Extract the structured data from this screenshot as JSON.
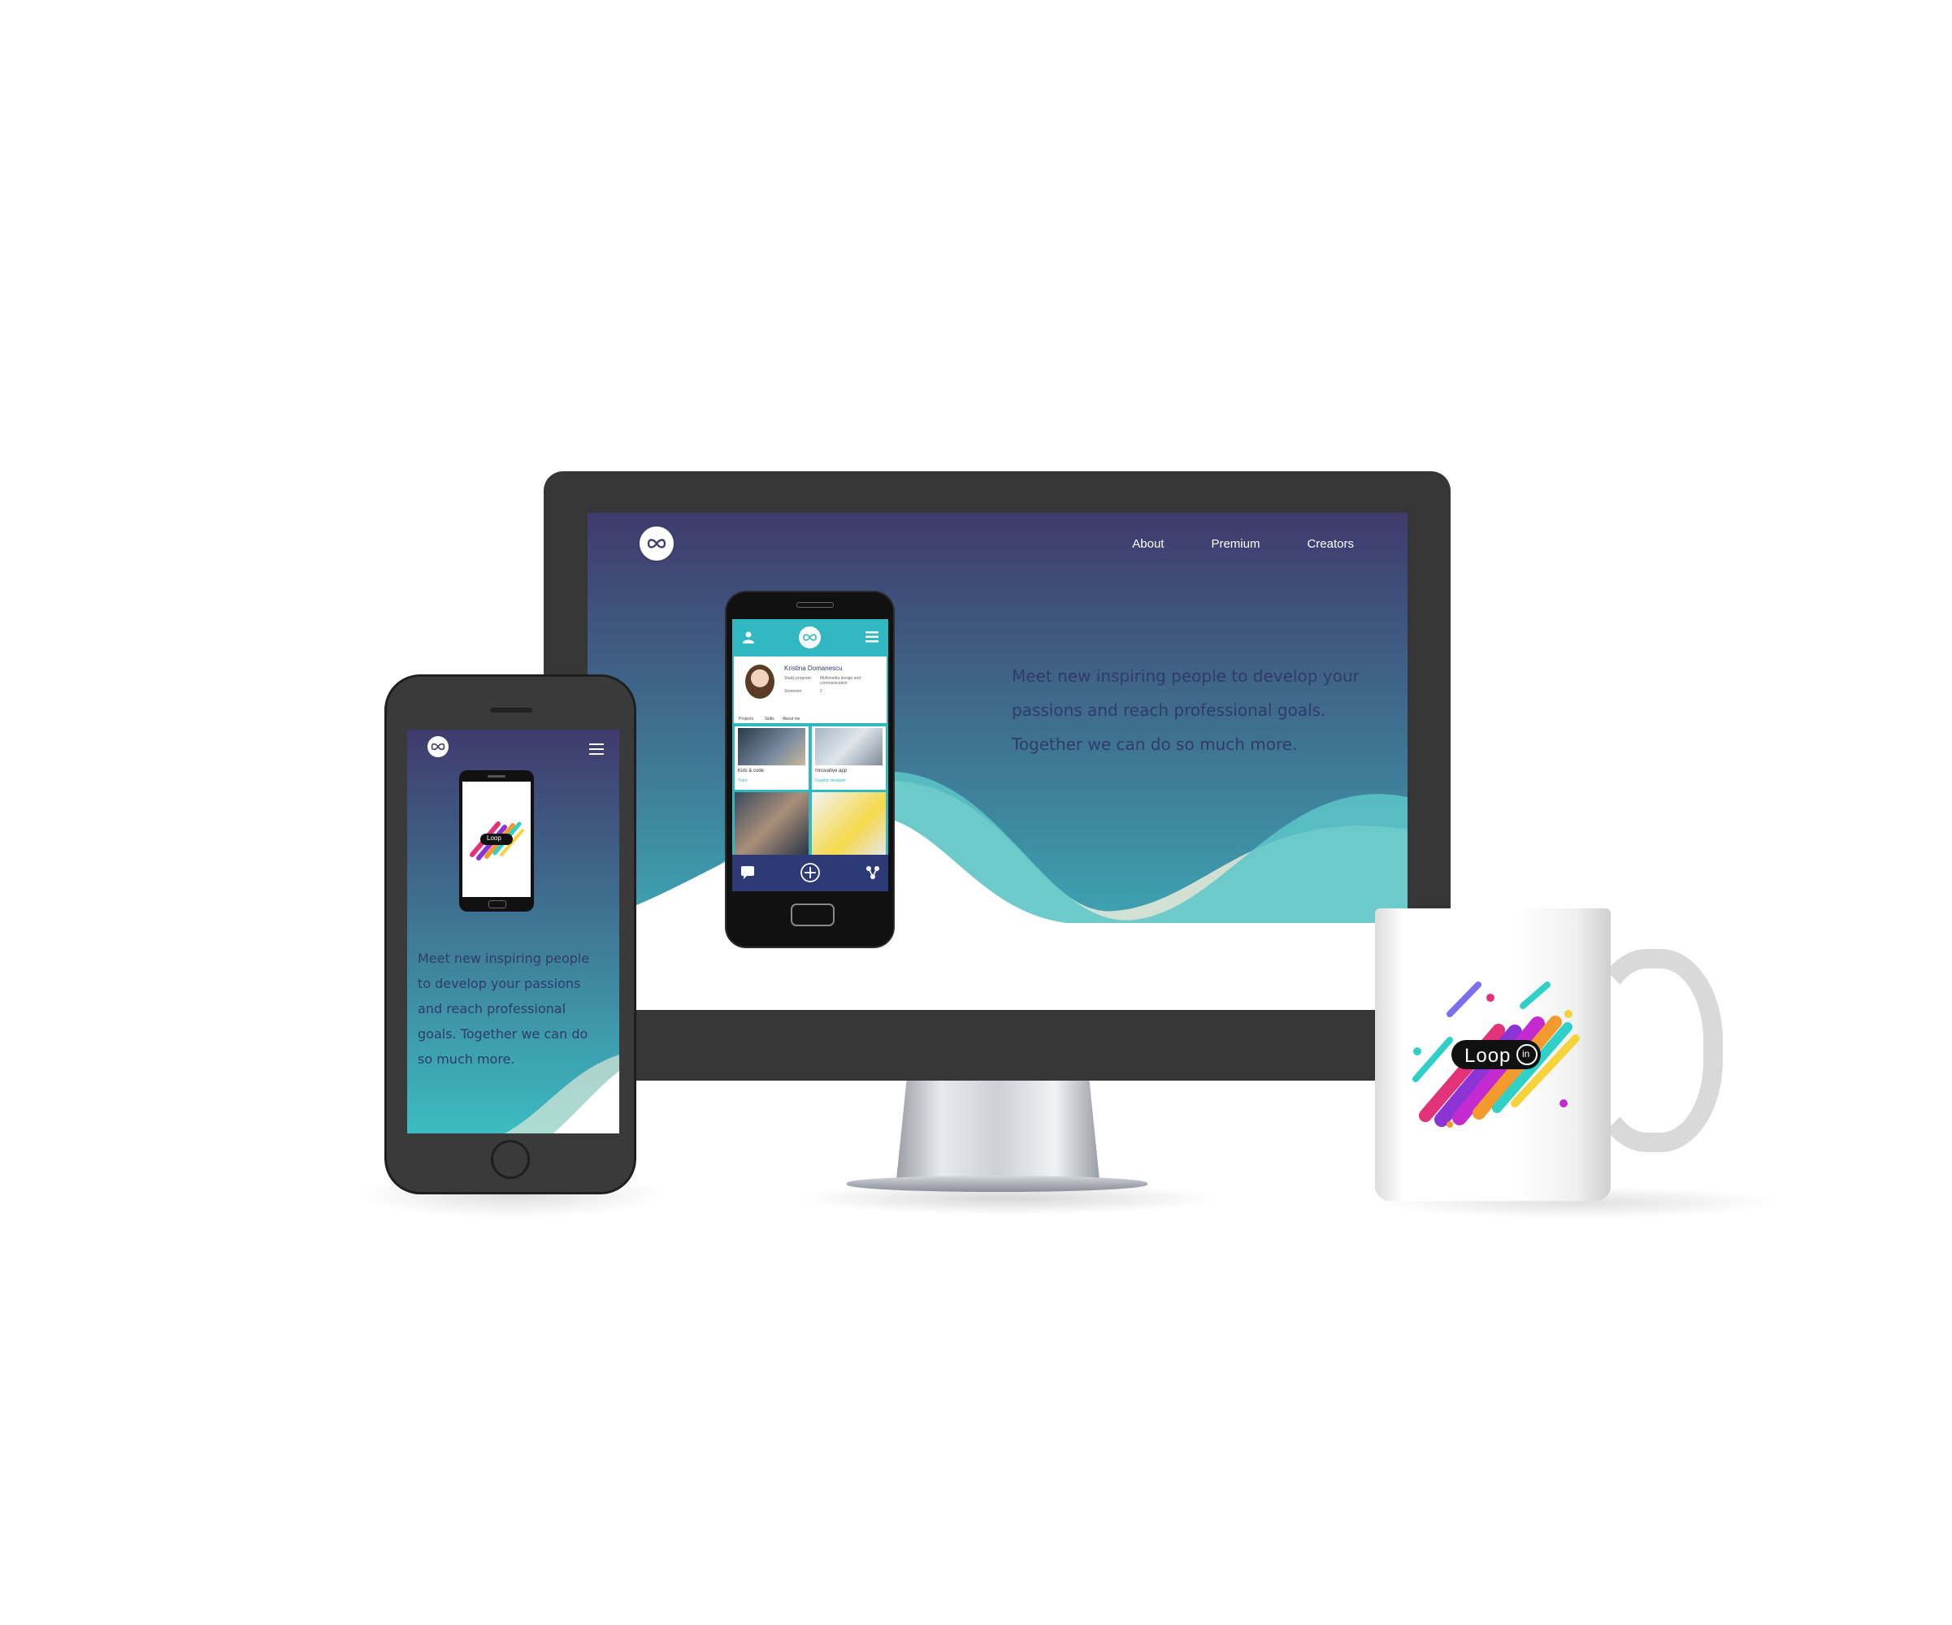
{
  "desktop_site": {
    "logo_icon": "infinity-logo-icon",
    "nav": [
      {
        "label": "About"
      },
      {
        "label": "Premium"
      },
      {
        "label": "Creators"
      }
    ],
    "hero_text": "Meet new inspiring people to develop your passions and reach professional goals. Together we can do so much more.",
    "colors": {
      "gradient_top": "#3f3a6d",
      "gradient_bottom": "#3bbcc2",
      "text": "#2f3b6b"
    }
  },
  "app_screen": {
    "profile_name": "Kristina Domanescu",
    "study_program_label": "Study program",
    "study_program_value": "Multimedia design and communication",
    "semester_label": "Semester",
    "semester_value": "2",
    "tabs": [
      {
        "label": "Projects"
      },
      {
        "label": "Skills"
      },
      {
        "label": "About me"
      }
    ],
    "projects": [
      {
        "title": "Kids & code",
        "role": "Tutor"
      },
      {
        "title": "Innovative app",
        "role": "Graphic designer"
      }
    ],
    "icons": [
      "user-icon",
      "infinity-logo-icon",
      "menu-icon",
      "chat-icon",
      "add-icon",
      "share-icon"
    ]
  },
  "mobile_site": {
    "hero_text": "Meet new inspiring people to develop your passions and reach professional goals. Together we can do so much more.",
    "icons": [
      "infinity-logo-icon",
      "menu-icon"
    ]
  },
  "mug": {
    "brand_text": "Loop",
    "brand_suffix": "in"
  }
}
